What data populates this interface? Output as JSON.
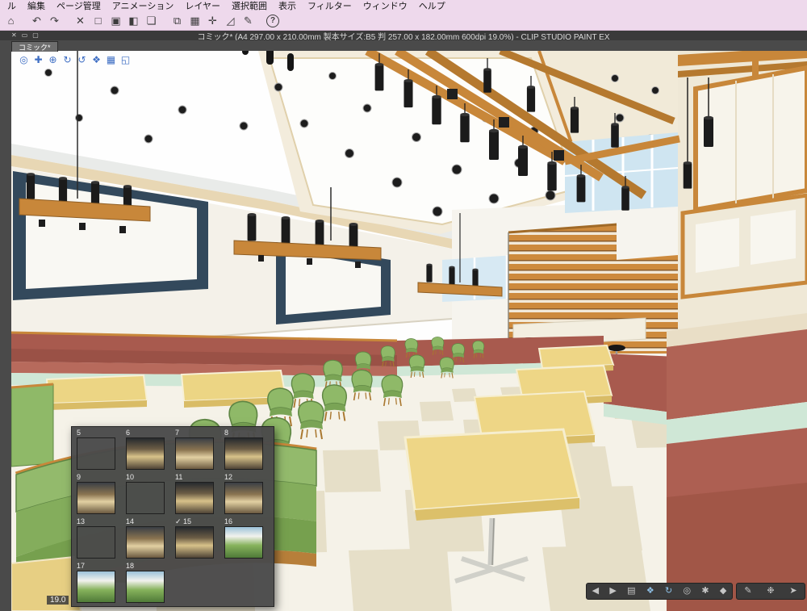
{
  "app": {
    "menu_items": [
      "ル",
      "編集",
      "ページ管理",
      "アニメーション",
      "レイヤー",
      "選択範囲",
      "表示",
      "フィルター",
      "ウィンドウ",
      "ヘルプ"
    ],
    "window_controls": [
      {
        "name": "close",
        "glyph": "✕"
      },
      {
        "name": "minimize",
        "glyph": "▭"
      },
      {
        "name": "maximize",
        "glyph": "▢"
      }
    ],
    "title": "コミック* (A4 297.00 x 210.00mm 製本サイズ:B5 判 257.00 x 182.00mm 600dpi 19.0%)  - CLIP STUDIO PAINT EX"
  },
  "toolbar": {
    "icons": [
      {
        "name": "clip-studio-home",
        "glyph": "⌂"
      },
      {
        "name": "undo",
        "glyph": "↶",
        "gap": true
      },
      {
        "name": "redo",
        "glyph": "↷"
      },
      {
        "name": "clear",
        "glyph": "✕",
        "gap": true
      },
      {
        "name": "deselect",
        "glyph": "□"
      },
      {
        "name": "select-all",
        "glyph": "▣"
      },
      {
        "name": "invert-selection",
        "glyph": "◧"
      },
      {
        "name": "new-layer",
        "glyph": "❏"
      },
      {
        "name": "transform",
        "glyph": "⧉",
        "gap": true
      },
      {
        "name": "grid",
        "glyph": "▦"
      },
      {
        "name": "guide",
        "glyph": "✛"
      },
      {
        "name": "ruler",
        "glyph": "◿"
      },
      {
        "name": "special-ruler",
        "glyph": "✎"
      },
      {
        "name": "help",
        "glyph": "?"
      }
    ]
  },
  "canvas": {
    "tab_label": "コミック*",
    "zoom_readout": "19.0"
  },
  "object_launcher": {
    "icons": [
      {
        "name": "camera-orbit",
        "glyph": "◎"
      },
      {
        "name": "camera-pan",
        "glyph": "✚"
      },
      {
        "name": "camera-zoom",
        "glyph": "⊕"
      },
      {
        "name": "rotate-cw",
        "glyph": "↻"
      },
      {
        "name": "rotate-ccw",
        "glyph": "↺"
      },
      {
        "name": "object-move",
        "glyph": "❖"
      },
      {
        "name": "grid-snap",
        "glyph": "▦"
      },
      {
        "name": "view-reset",
        "glyph": "◱"
      }
    ]
  },
  "material_panel": {
    "selected_mark": "✓",
    "items": [
      {
        "num": "5",
        "variant": "a"
      },
      {
        "num": "6",
        "variant": "b"
      },
      {
        "num": "7",
        "variant": "c"
      },
      {
        "num": "8",
        "variant": "b"
      },
      {
        "num": "9",
        "variant": "c"
      },
      {
        "num": "10",
        "variant": "a"
      },
      {
        "num": "11",
        "variant": "b"
      },
      {
        "num": "12",
        "variant": "c"
      },
      {
        "num": "13",
        "variant": "a"
      },
      {
        "num": "14",
        "variant": "c"
      },
      {
        "num": "15",
        "variant": "b",
        "selected": true
      },
      {
        "num": "16",
        "variant": "g"
      },
      {
        "num": "17",
        "variant": "g"
      },
      {
        "num": "18",
        "variant": "g"
      }
    ]
  },
  "object_toolbar": {
    "icons": [
      {
        "name": "prev-angle",
        "glyph": "◀"
      },
      {
        "name": "next-angle",
        "glyph": "▶"
      },
      {
        "name": "object-list",
        "glyph": "▤"
      },
      {
        "name": "move-mode",
        "glyph": "❖",
        "tone": "blue"
      },
      {
        "name": "rotate-mode",
        "glyph": "↻",
        "tone": "blue"
      },
      {
        "name": "camera-mode",
        "glyph": "◎"
      },
      {
        "name": "light-setting",
        "glyph": "✱"
      },
      {
        "name": "detail-setting",
        "glyph": "◆"
      }
    ]
  },
  "tool_toolbar": {
    "icons": [
      {
        "name": "pen-tool",
        "glyph": "✎"
      },
      {
        "name": "decoration-tool",
        "glyph": "❉"
      },
      {
        "name": "operation-tool",
        "glyph": "➤"
      }
    ]
  },
  "colors": {
    "menu_bar_bg": "#eed9ec",
    "title_bar_bg": "#3a3a3a",
    "panel_bg": "#4b4b4b",
    "launcher_icon_blue": "#3f6fc4",
    "wood": "#c8873a",
    "chair_green": "#8fb968",
    "booth_maroon": "#ad5f52",
    "booth_mint": "#cfe7d6",
    "table_yellow": "#ecd584",
    "frame_navy": "#33495c",
    "sky_blue": "#cfe5f1"
  }
}
